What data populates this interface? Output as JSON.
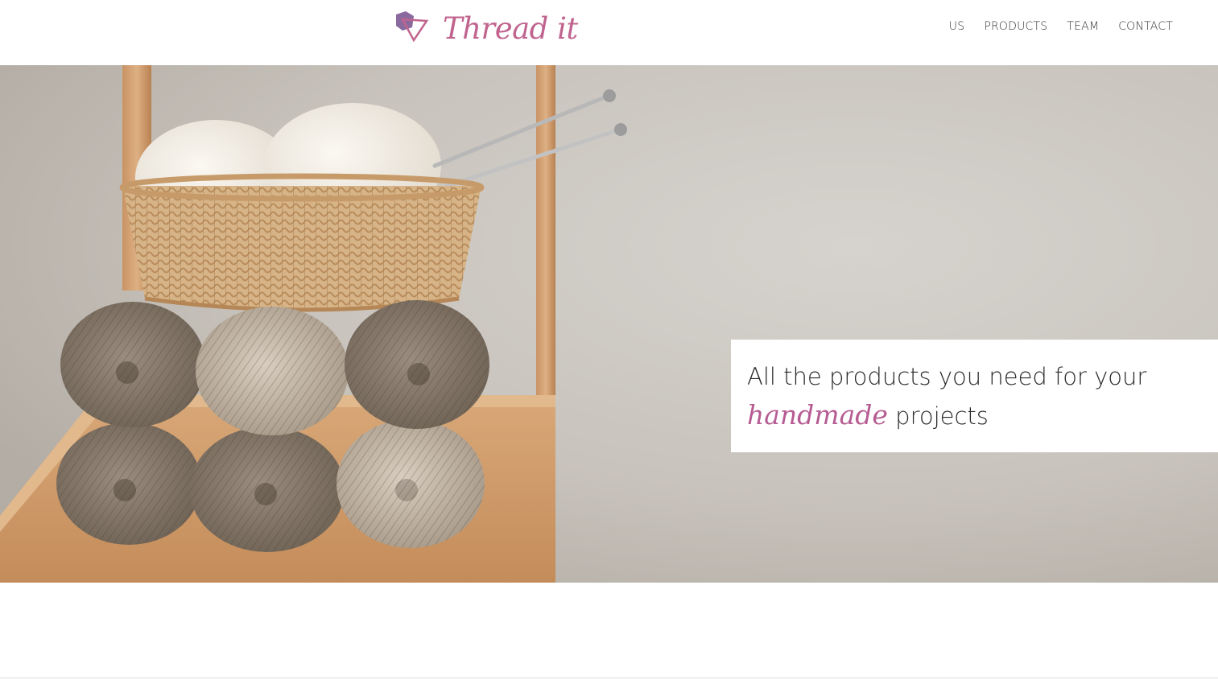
{
  "header": {
    "logo_text": "Thread it",
    "nav": [
      {
        "label": "US"
      },
      {
        "label": "PRODUCTS"
      },
      {
        "label": "TEAM"
      },
      {
        "label": "CONTACT"
      }
    ]
  },
  "hero": {
    "tagline_line1": "All the products you need for your",
    "tagline_highlight": "handmade",
    "tagline_line2_rest": " projects"
  },
  "colors": {
    "brand": "#c0648f",
    "brand_dark": "#8a5a8f",
    "text": "#2b2b2b"
  },
  "icons": {
    "logo": "thread-it-logo-icon"
  }
}
